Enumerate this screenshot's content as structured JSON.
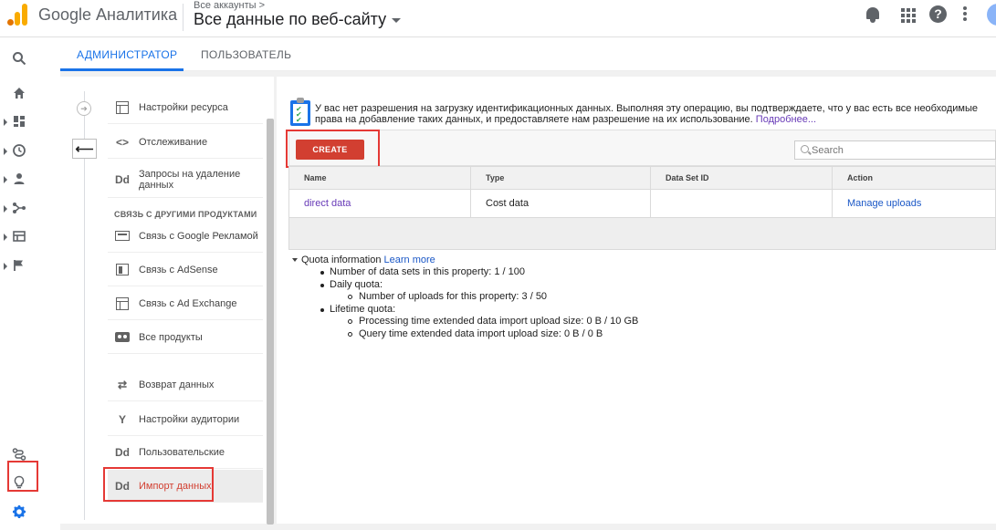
{
  "header": {
    "app_name": "Google Аналитика",
    "account_breadcrumb": "Все аккаунты",
    "breadcrumb_chevron": ">",
    "property_view": "Все данные по веб-сайту",
    "help_glyph": "?",
    "brand_colors": {
      "orange": "#e37400",
      "yellow": "#f9ab00"
    }
  },
  "tabs": [
    {
      "label": "АДМИНИСТРАТОР",
      "active": true
    },
    {
      "label": "ПОЛЬЗОВАТЕЛЬ",
      "active": false
    }
  ],
  "left_rail": {
    "icons": [
      "search-icon",
      "home-icon",
      "dashboard-icon",
      "clock-icon",
      "person-icon",
      "acquisition-icon",
      "behavior-icon",
      "flag-icon",
      "discover-icon",
      "lightbulb-icon",
      "gear-icon"
    ],
    "active": "gear-icon"
  },
  "admin_nav": {
    "back_glyph": "⟵",
    "items_top": [
      {
        "label": "Настройки ресурса",
        "icon": "box-icon"
      },
      {
        "label": "Отслеживание",
        "icon": "code-icon",
        "icon_text": "<>"
      },
      {
        "label": "Запросы на удаление данных",
        "icon": "dd-icon",
        "icon_text": "Dd"
      }
    ],
    "section_title": "СВЯЗЬ С ДРУГИМИ ПРОДУКТАМИ",
    "items_linking": [
      {
        "label": "Связь с Google Рекламой",
        "icon": "ads-icon"
      },
      {
        "label": "Связь с AdSense",
        "icon": "adsense-icon"
      },
      {
        "label": "Связь с Ad Exchange",
        "icon": "box-icon"
      },
      {
        "label": "Все продукты",
        "icon": "products-icon"
      }
    ],
    "items_bottom": [
      {
        "label": "Возврат данных",
        "icon": "sync-icon",
        "icon_text": "⇄"
      },
      {
        "label": "Настройки аудитории",
        "icon": "audience-icon",
        "icon_text": "Y"
      },
      {
        "label": "Пользовательские",
        "icon": "dd-icon",
        "icon_text": "Dd"
      },
      {
        "label": "Импорт данных",
        "icon": "dd-icon",
        "icon_text": "Dd",
        "active": true
      }
    ]
  },
  "notice": {
    "text": "У вас нет разрешения на загрузку идентификационных данных. Выполняя эту операцию, вы подтверждаете, что у вас есть все необходимые права на добавление таких данных, и предоставляете нам разрешение на их использование.",
    "link": "Подробнее..."
  },
  "toolbar": {
    "create_label": "CREATE",
    "search_placeholder": "Search",
    "search_value": ""
  },
  "table": {
    "columns": [
      "Name",
      "Type",
      "Data Set ID",
      "Action"
    ],
    "rows": [
      {
        "name": "direct data",
        "type": "Cost data",
        "data_set_id": "",
        "action": "Manage uploads"
      }
    ]
  },
  "quota": {
    "title": "Quota information",
    "learn_more": "Learn more",
    "lines": [
      {
        "level": 1,
        "text": "Number of data sets in this property: 1 / 100"
      },
      {
        "level": 1,
        "text": "Daily quota:"
      },
      {
        "level": 2,
        "text": "Number of uploads for this property: 3 / 50"
      },
      {
        "level": 1,
        "text": "Lifetime quota:"
      },
      {
        "level": 2,
        "text": "Processing time extended data import upload size: 0 B / 10 GB"
      },
      {
        "level": 2,
        "text": "Query time extended data import upload size: 0 B / 0 B"
      }
    ]
  },
  "colors": {
    "accent_blue": "#1a73e8",
    "create_red": "#d23f31",
    "highlight_red": "#e53935",
    "link_purple": "#673ab7"
  }
}
